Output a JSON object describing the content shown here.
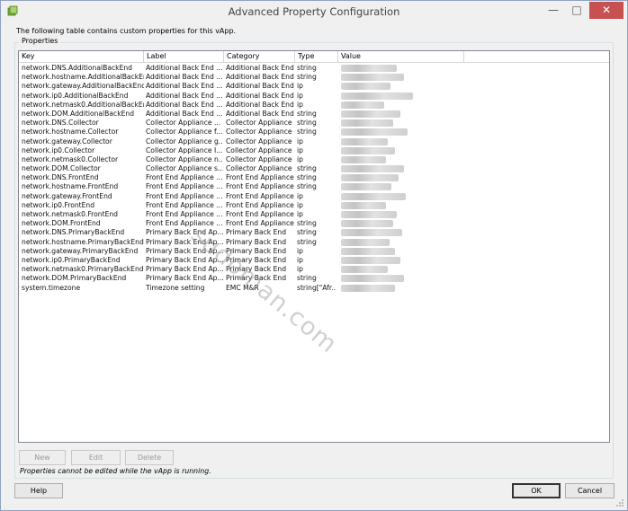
{
  "window": {
    "title": "Advanced Property Configuration"
  },
  "description": "The following table contains custom properties for this vApp.",
  "group_label": "Properties",
  "columns": [
    "Key",
    "Label",
    "Category",
    "Type",
    "Value"
  ],
  "rows": [
    {
      "key": "network.DNS.AdditionalBackEnd",
      "label": "Additional Back End ...",
      "category": "Additional Back End",
      "type": "string"
    },
    {
      "key": "network.hostname.AdditionalBackEnd",
      "label": "Additional Back End ...",
      "category": "Additional Back End",
      "type": "string"
    },
    {
      "key": "network.gateway.AdditionalBackEnd",
      "label": "Additional Back End ...",
      "category": "Additional Back End",
      "type": "ip"
    },
    {
      "key": "network.ip0.AdditionalBackEnd",
      "label": "Additional Back End ...",
      "category": "Additional Back End",
      "type": "ip"
    },
    {
      "key": "network.netmask0.AdditionalBackEnd",
      "label": "Additional Back End ...",
      "category": "Additional Back End",
      "type": "ip"
    },
    {
      "key": "network.DOM.AdditionalBackEnd",
      "label": "Additional Back End ...",
      "category": "Additional Back End",
      "type": "string"
    },
    {
      "key": "network.DNS.Collector",
      "label": "Collector Appliance ...",
      "category": "Collector Appliance",
      "type": "string"
    },
    {
      "key": "network.hostname.Collector",
      "label": "Collector Appliance f...",
      "category": "Collector Appliance",
      "type": "string"
    },
    {
      "key": "network.gateway.Collector",
      "label": "Collector Appliance g...",
      "category": "Collector Appliance",
      "type": "ip"
    },
    {
      "key": "network.ip0.Collector",
      "label": "Collector Appliance I...",
      "category": "Collector Appliance",
      "type": "ip"
    },
    {
      "key": "network.netmask0.Collector",
      "label": "Collector Appliance n...",
      "category": "Collector Appliance",
      "type": "ip"
    },
    {
      "key": "network.DOM.Collector",
      "label": "Collector Appliance s...",
      "category": "Collector Appliance",
      "type": "string"
    },
    {
      "key": "network.DNS.FrontEnd",
      "label": "Front End Appliance ...",
      "category": "Front End Appliance",
      "type": "string"
    },
    {
      "key": "network.hostname.FrontEnd",
      "label": "Front End Appliance ...",
      "category": "Front End Appliance",
      "type": "string"
    },
    {
      "key": "network.gateway.FrontEnd",
      "label": "Front End Appliance ...",
      "category": "Front End Appliance",
      "type": "ip"
    },
    {
      "key": "network.ip0.FrontEnd",
      "label": "Front End Appliance ...",
      "category": "Front End Appliance",
      "type": "ip"
    },
    {
      "key": "network.netmask0.FrontEnd",
      "label": "Front End Appliance ...",
      "category": "Front End Appliance",
      "type": "ip"
    },
    {
      "key": "network.DOM.FrontEnd",
      "label": "Front End Appliance ...",
      "category": "Front End Appliance",
      "type": "string"
    },
    {
      "key": "network.DNS.PrimaryBackEnd",
      "label": "Primary Back End Ap...",
      "category": "Primary Back End",
      "type": "string"
    },
    {
      "key": "network.hostname.PrimaryBackEnd",
      "label": "Primary Back End Ap...",
      "category": "Primary Back End",
      "type": "string"
    },
    {
      "key": "network.gateway.PrimaryBackEnd",
      "label": "Primary Back End Ap...",
      "category": "Primary Back End",
      "type": "ip"
    },
    {
      "key": "network.ip0.PrimaryBackEnd",
      "label": "Primary Back End Ap...",
      "category": "Primary Back End",
      "type": "ip"
    },
    {
      "key": "network.netmask0.PrimaryBackEnd",
      "label": "Primary Back End Ap...",
      "category": "Primary Back End",
      "type": "ip"
    },
    {
      "key": "network.DOM.PrimaryBackEnd",
      "label": "Primary Back End Ap...",
      "category": "Primary Back End",
      "type": "string"
    },
    {
      "key": "system.timezone",
      "label": "Timezone setting",
      "category": "EMC M&R",
      "type": "string[\"Afr..."
    }
  ],
  "buttons": {
    "new": "New",
    "edit": "Edit",
    "delete": "Delete",
    "help": "Help",
    "ok": "OK",
    "cancel": "Cancel"
  },
  "note": "Properties cannot be edited while the vApp is running.",
  "watermark": "sudoman.com"
}
